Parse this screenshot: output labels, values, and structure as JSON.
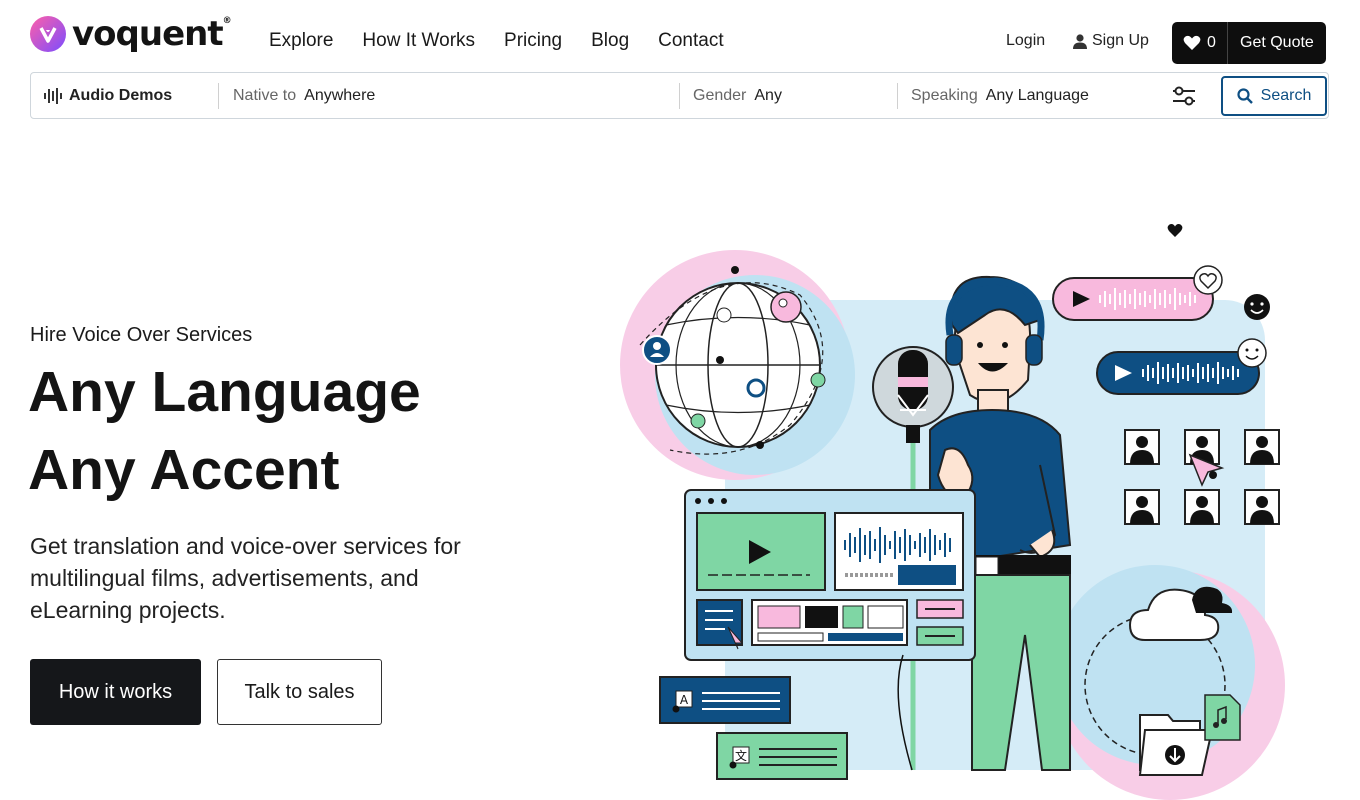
{
  "brand": {
    "name": "voquent",
    "trademark": "®"
  },
  "nav": [
    "Explore",
    "How It Works",
    "Pricing",
    "Blog",
    "Contact"
  ],
  "header": {
    "login": "Login",
    "signup": "Sign Up",
    "favorites_count": "0",
    "get_quote": "Get Quote"
  },
  "search": {
    "audio_demos": "Audio Demos",
    "native_label": "Native to",
    "native_value": "Anywhere",
    "gender_label": "Gender",
    "gender_value": "Any",
    "speaking_label": "Speaking",
    "speaking_value": "Any Language",
    "search_label": "Search"
  },
  "hero": {
    "eyebrow": "Hire Voice Over Services",
    "title_line1": "Any Language",
    "title_line2": "Any Accent",
    "subtitle": "Get translation and voice-over services for multilingual films, advertisements, and eLearning projects.",
    "primary_cta": "How it works",
    "secondary_cta": "Talk to sales"
  },
  "colors": {
    "accent_blue": "#0e4f83",
    "pink": "#f7b6dd",
    "light_blue": "#bfe2f2",
    "green": "#7fd6a4",
    "dark": "#15171a"
  },
  "illustration": {
    "glyph_a": "A",
    "glyph_wen": "文"
  }
}
